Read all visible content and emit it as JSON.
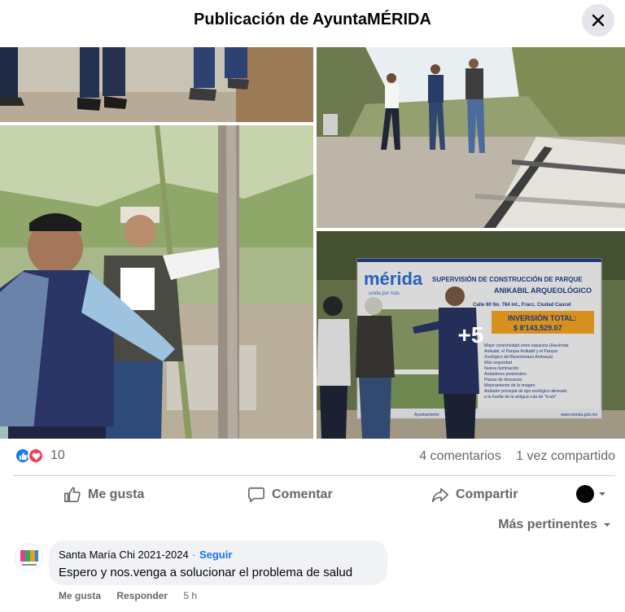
{
  "header": {
    "title": "Publicación de AyuntaMÉRIDA",
    "close_icon": "close-icon"
  },
  "photos": {
    "more_label": "+5",
    "sign": {
      "logo": "mérida",
      "logo_tagline": "unida por más",
      "heading_line1": "SUPERVISIÓN DE CONSTRUCCIÓN DE PARQUE",
      "heading_line2": "ANIKABIL ARQUEOLÓGICO",
      "address": "Calle 60 No. 784 int., Fracc. Ciudad Caucel",
      "investment_label": "INVERSIÓN TOTAL:",
      "investment_value": "$ 8'143,529.07",
      "bullets": [
        "Mejor conectividad entre espacios (Hacienda",
        "Anikabil, el Parque Anikabil y el Parque",
        "Zoológico del Bicentenario Animaya)",
        "Más seguridad",
        "Nueva iluminación",
        "Andadores peatonales",
        "Plazas de descanso",
        "Mejoramiento de la imagen",
        "Andador principal de tipo ecológico alineado",
        "a la huella de la antigua ruta de \"truck\""
      ],
      "footer_left": "Ayuntamiento",
      "footer_right": "www.merida.gob.mx"
    }
  },
  "stats": {
    "reactions": [
      "like-icon",
      "love-icon"
    ],
    "reaction_count": "10",
    "comments": "4 comentarios",
    "shares": "1 vez compartido"
  },
  "actions": {
    "like": "Me gusta",
    "comment": "Comentar",
    "share": "Compartir"
  },
  "sort": {
    "label": "Más pertinentes"
  },
  "comment": {
    "author": "Santa María Chi 2021-2024",
    "separator": "·",
    "follow": "Seguir",
    "text": "Espero y nos.venga a solucionar el problema de salud",
    "like": "Me gusta",
    "reply": "Responder",
    "time": "5 h"
  },
  "colors": {
    "accent": "#1877f2",
    "love": "#f33e58",
    "muted": "#65676b",
    "bubble": "#f0f2f5"
  }
}
